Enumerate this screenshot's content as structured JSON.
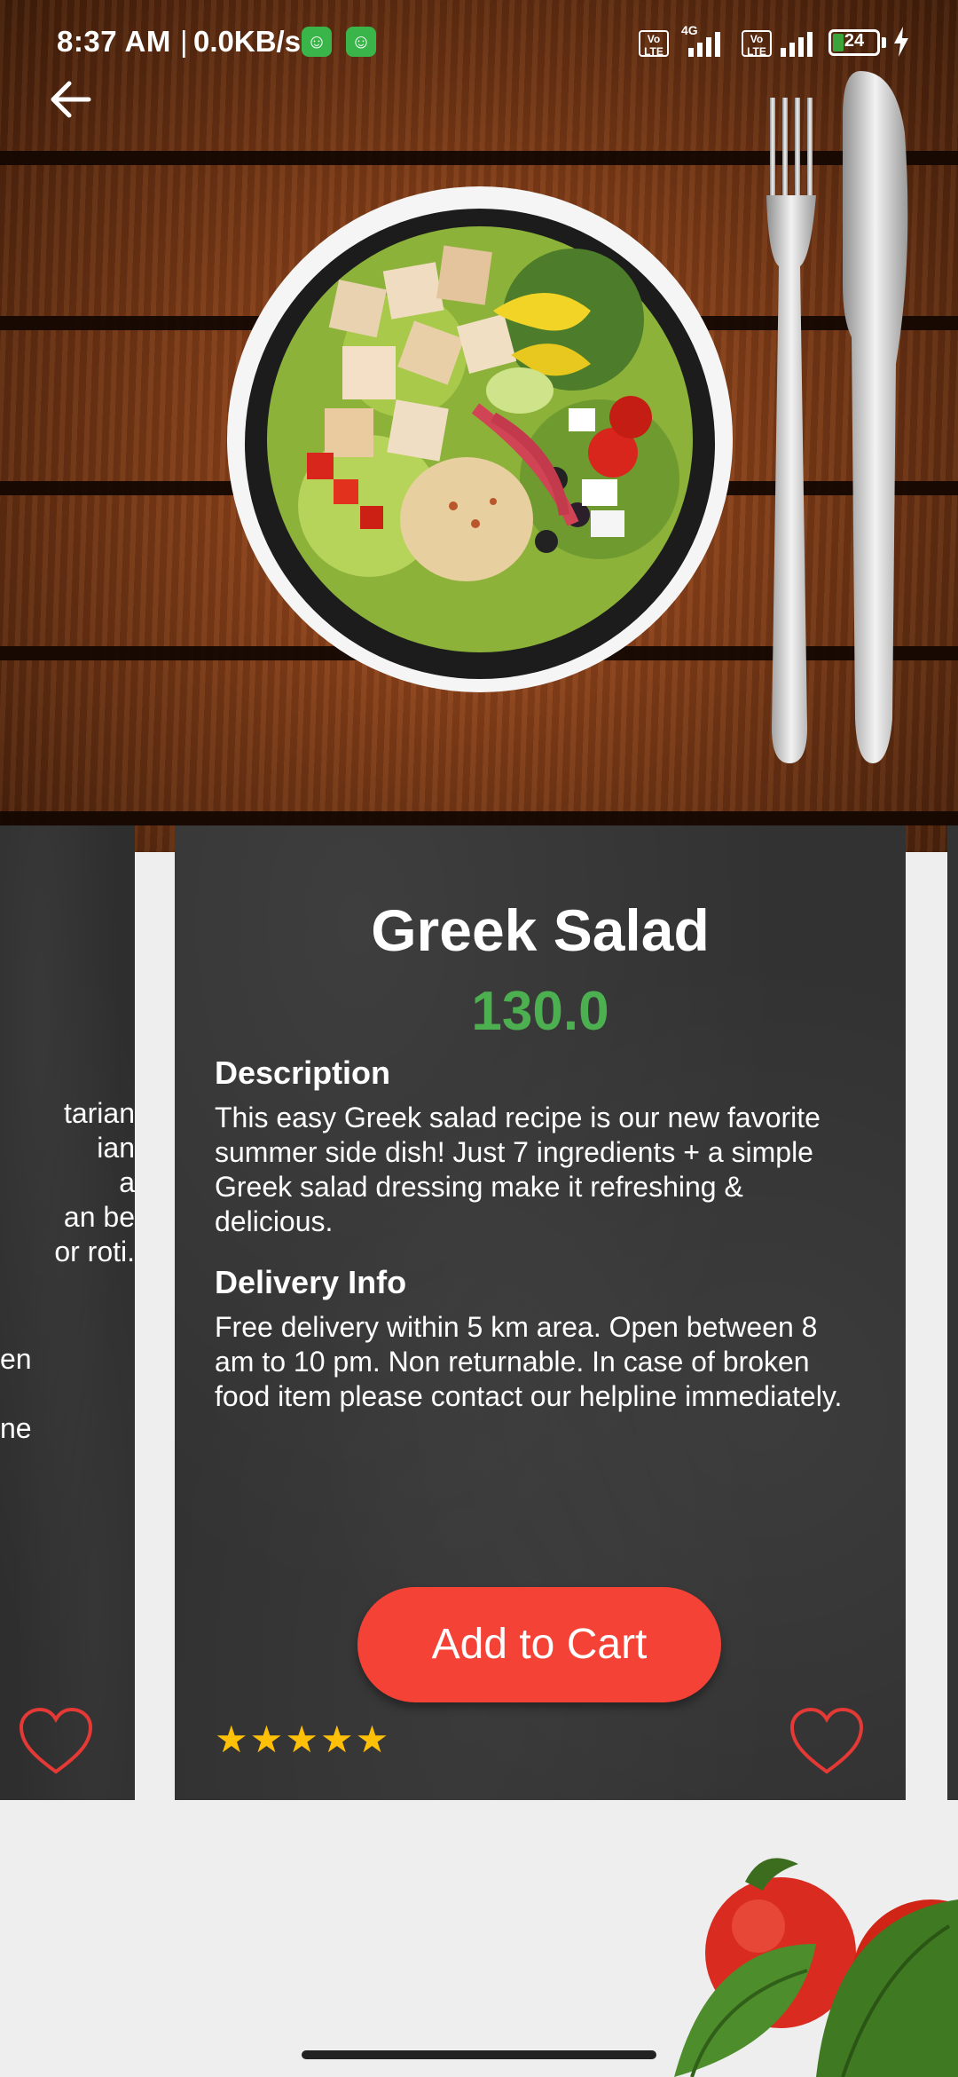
{
  "status_bar": {
    "time": "8:37 AM",
    "separator": "|",
    "speed": "0.0KB/s",
    "sim1_label": "Vo LTE",
    "network_label": "4G",
    "sim2_label": "Vo LTE",
    "battery_percent": "24",
    "battery_level": 0.24
  },
  "colors": {
    "price": "#4caf50",
    "add_to_cart": "#f44336",
    "heart": "#e53935",
    "star": "#ffc107",
    "card_bg": "#323232"
  },
  "product": {
    "name": "Greek Salad",
    "price": "130.0",
    "description_heading": "Description",
    "description": "This easy Greek salad recipe is our new favorite summer side dish! Just 7 ingredients + a simple Greek salad dressing make it refreshing & delicious.",
    "delivery_heading": "Delivery Info",
    "delivery_info": "Free delivery within 5 km area. Open between 8 am to 10 pm. Non returnable. In case of broken food item please contact our helpline immediately.",
    "add_to_cart_label": "Add to Cart",
    "rating": 5,
    "rating_max": 5
  },
  "prev_card": {
    "description_fragment": "tarian\nian\n a\nan be\nor roti.",
    "delivery_fragment": "en\n\nne"
  },
  "icons": {
    "back": "arrow-left-icon",
    "favorite": "heart-outline-icon",
    "star": "star-icon",
    "charging": "bolt-icon"
  }
}
